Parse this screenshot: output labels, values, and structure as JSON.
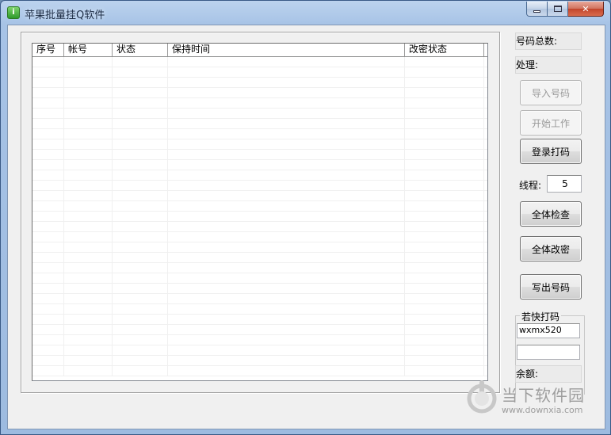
{
  "window": {
    "title": "苹果批量挂Q软件",
    "icon": "app-icon",
    "icon_glyph": "i",
    "close_glyph": "✕"
  },
  "list": {
    "columns": [
      "序号",
      "帐号",
      "状态",
      "保持时间",
      "改密状态"
    ],
    "rows": []
  },
  "sidebar": {
    "total_label": "号码总数:",
    "process_label": "处理:",
    "import_button": "导入号码",
    "start_button": "开始工作",
    "login_captcha_button": "登录打码",
    "threads_label": "线程:",
    "threads_value": "5",
    "check_all_button": "全体检查",
    "change_all_button": "全体改密",
    "export_button": "写出号码"
  },
  "captcha_group": {
    "title": "若快打码",
    "username": "wxmx520",
    "password": "",
    "balance_label": "余额:"
  },
  "watermark": {
    "name": "当下软件园",
    "url": "www.downxia.com"
  }
}
